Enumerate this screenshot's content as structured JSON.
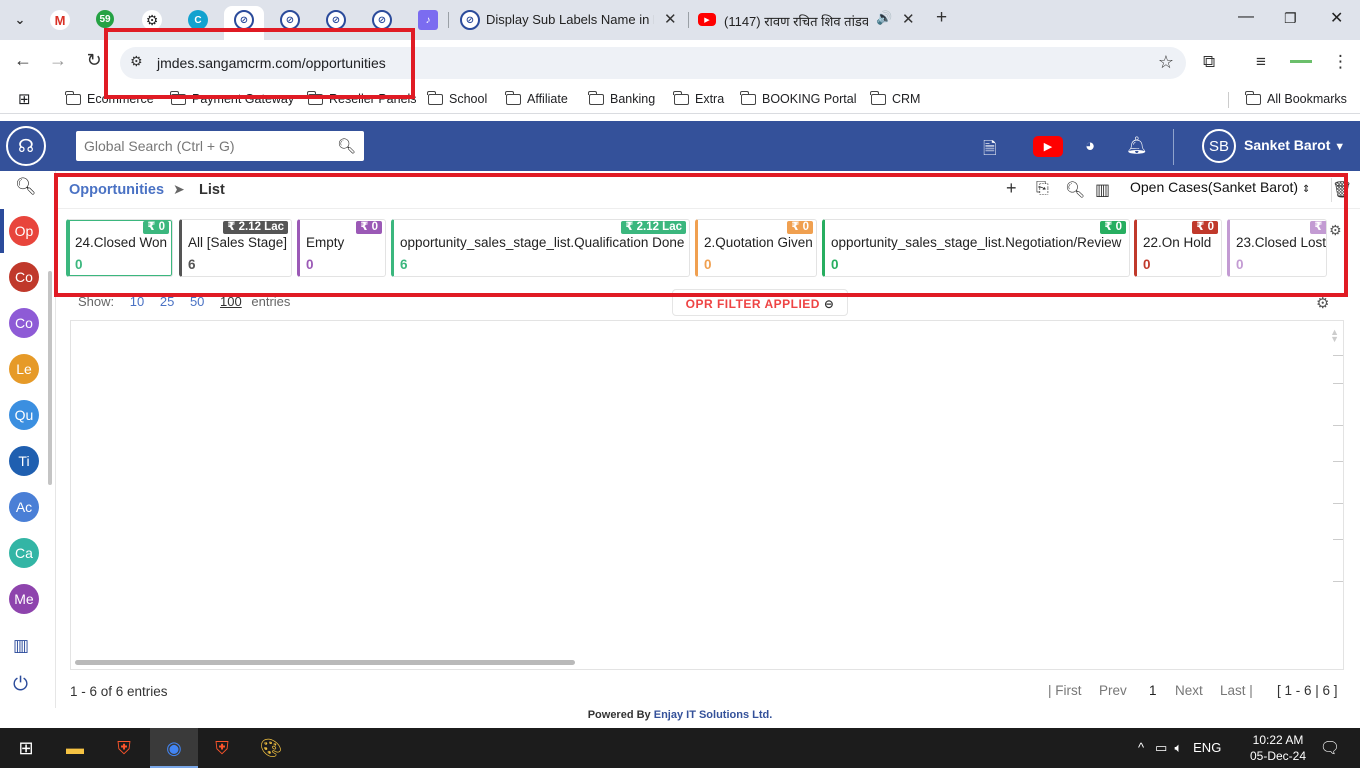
{
  "browser": {
    "tabs": [
      {
        "title": "Display Sub Labels Name in Dro"
      },
      {
        "title": "(1147) रावण रचित शिव तांडव"
      }
    ],
    "gmail_badge": "59",
    "url": "jmdes.sangamcrm.com/opportunities",
    "bookmarks": [
      "Ecommerce",
      "Payment Gateway",
      "Reseller Panels",
      "School",
      "Affiliate",
      "Banking",
      "Extra",
      "BOOKING Portal",
      "CRM"
    ],
    "all_bookmarks": "All Bookmarks"
  },
  "header": {
    "search_placeholder": "Global Search (Ctrl + G)",
    "avatar_initials": "SB",
    "user_name": "Sanket Barot"
  },
  "sidebar": {
    "items": [
      {
        "label": "Op",
        "color": "#e8453c"
      },
      {
        "label": "Co",
        "color": "#c0392b"
      },
      {
        "label": "Co",
        "color": "#8e5bd6"
      },
      {
        "label": "Le",
        "color": "#e69a28"
      },
      {
        "label": "Qu",
        "color": "#3b8fe0"
      },
      {
        "label": "Ti",
        "color": "#1f5fb0"
      },
      {
        "label": "Ac",
        "color": "#4a7fd6"
      },
      {
        "label": "Ca",
        "color": "#33b5a5"
      },
      {
        "label": "Me",
        "color": "#8e44ad"
      }
    ]
  },
  "breadcrumb": {
    "module": "Opportunities",
    "view": "List"
  },
  "list_filter": "Open Cases(Sanket Barot)",
  "stages": [
    {
      "label": "24.Closed Won",
      "count": "0",
      "amount": "₹ 0",
      "color": "#3bb77e"
    },
    {
      "label": "All [Sales Stage]",
      "count": "6",
      "amount": "₹ 2.12 Lac",
      "color": "#555555"
    },
    {
      "label": "Empty",
      "count": "0",
      "amount": "₹ 0",
      "color": "#9b59b6"
    },
    {
      "label": "opportunity_sales_stage_list.Qualification Done",
      "count": "6",
      "amount": "₹ 2.12 Lac",
      "color": "#3bb77e"
    },
    {
      "label": "2.Quotation Given",
      "count": "0",
      "amount": "₹ 0",
      "color": "#f0a050"
    },
    {
      "label": "opportunity_sales_stage_list.Negotiation/Review",
      "count": "0",
      "amount": "₹ 0",
      "color": "#27ae60"
    },
    {
      "label": "22.On Hold",
      "count": "0",
      "amount": "₹ 0",
      "color": "#c0392b"
    },
    {
      "label": "23.Closed Lost",
      "count": "0",
      "amount": "₹ 0",
      "color": "#c39bd3"
    }
  ],
  "entries": {
    "show_label": "Show:",
    "options": [
      "10",
      "25",
      "50",
      "100"
    ],
    "suffix": "entries",
    "opr_filter": "OPR FILTER APPLIED"
  },
  "footer": {
    "count_info": "1 - 6 of 6 entries",
    "first": "| First",
    "prev": "Prev",
    "page": "1",
    "next": "Next",
    "last": "Last |",
    "range": "[ 1 - 6 | 6 ]",
    "powered_prefix": "Powered By",
    "powered_company": "Enjay IT Solutions Ltd."
  },
  "taskbar": {
    "lang": "ENG",
    "time": "10:22 AM",
    "date": "05-Dec-24"
  }
}
